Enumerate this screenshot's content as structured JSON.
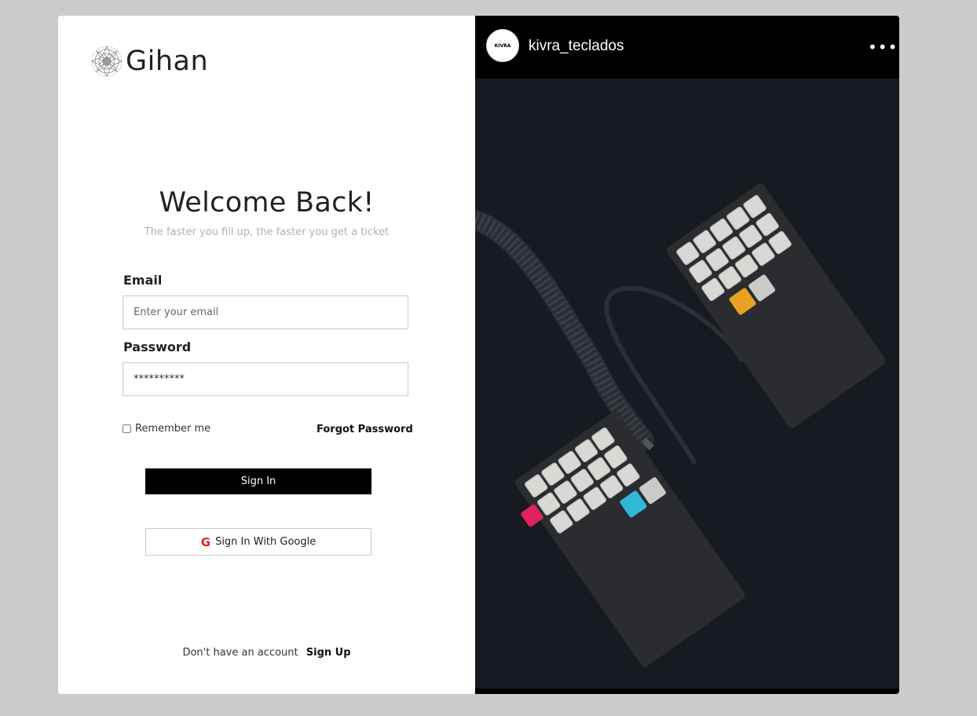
{
  "brand": {
    "name": "Gihan"
  },
  "login": {
    "heading": "Welcome Back!",
    "subtitle": "The faster you fill up, the faster you get a ticket",
    "email_label": "Email",
    "email_placeholder": "Enter your email",
    "password_label": "Password",
    "password_value": "**********",
    "remember_label": "Remember me",
    "forgot_label": "Forgot Password",
    "signin_label": "Sign In",
    "google_label": "Sign In With Google",
    "google_icon": "G",
    "signup_prompt": "Don't have an account",
    "signup_label": "Sign Up"
  },
  "instagram": {
    "username": "kivra_teclados",
    "avatar_text": "KIVRA",
    "more_icon": "•••"
  }
}
